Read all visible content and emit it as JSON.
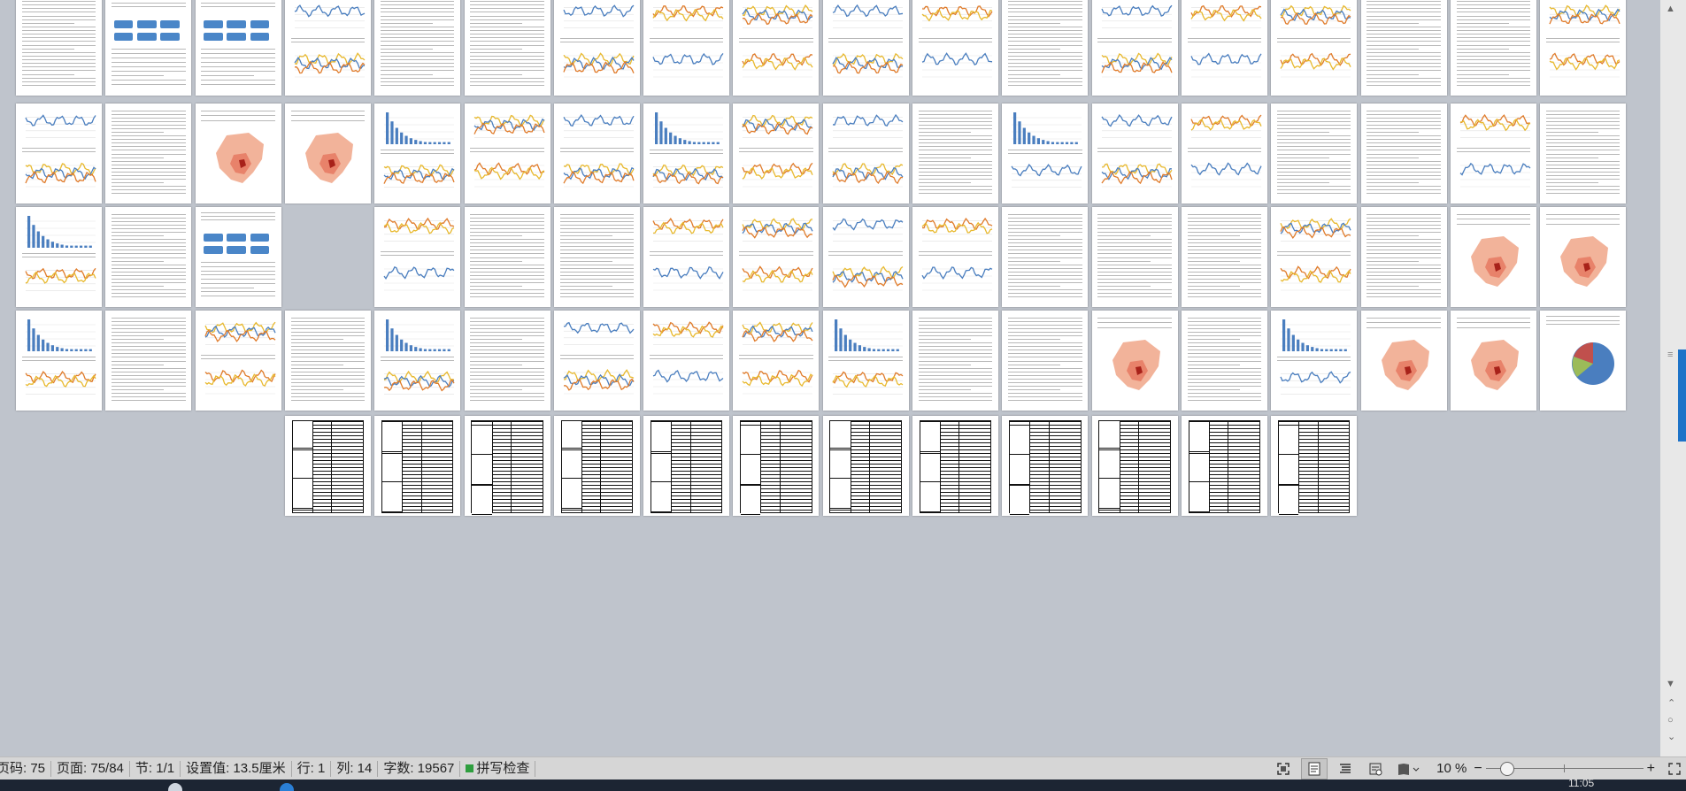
{
  "status_bar": {
    "page_no": "页码: 75",
    "page_count": "页面: 75/84",
    "section": "节: 1/1",
    "set_value": "设置值: 13.5厘米",
    "row": "行: 1",
    "col": "列: 14",
    "word_count": "字数: 19567",
    "spell_check": "拼写检查"
  },
  "zoom": {
    "label": "10 %",
    "minus": "−",
    "plus": "+",
    "level": 10
  },
  "taskbar": {
    "clock": "11:05"
  },
  "icons": [
    "fullscreen-icon",
    "page-view-icon",
    "outline-view-icon",
    "web-view-icon",
    "reading-mode-icon",
    "fit-window-icon",
    "scroll-up-icon",
    "scroll-down-icon"
  ],
  "colors": {
    "accent": "#1e73c8",
    "chart_blue": "#4a7ebf",
    "chart_orange": "#e07b2a",
    "chart_yellow": "#e8b92e",
    "map_red": "#d9553c",
    "spell_green": "#2e9e3e"
  },
  "document": {
    "total_pages": 84,
    "current_page": 75
  }
}
